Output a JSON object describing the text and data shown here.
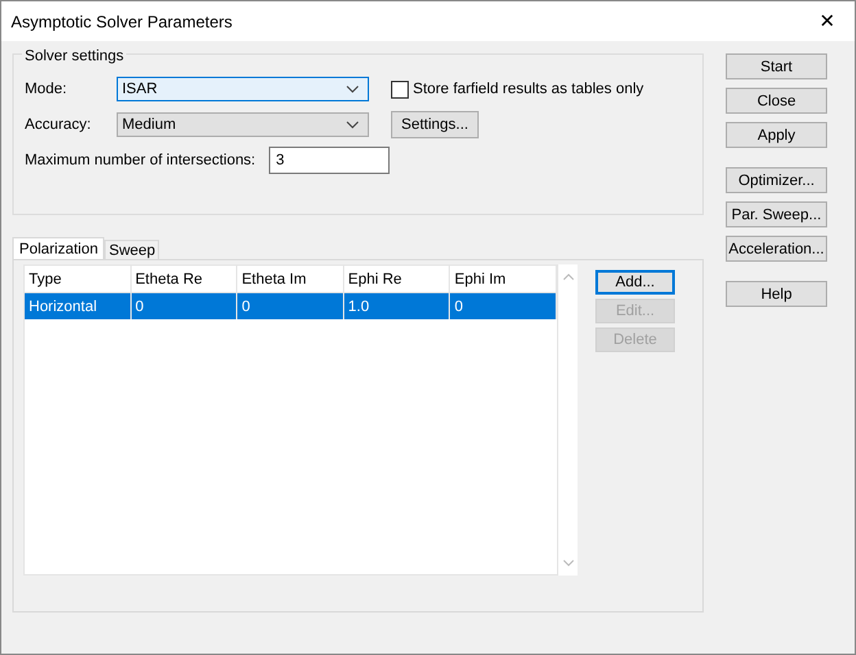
{
  "window": {
    "title": "Asymptotic Solver Parameters",
    "close": "✕"
  },
  "solver_settings": {
    "title": "Solver settings",
    "mode": {
      "label": "Mode:",
      "value": "ISAR",
      "focused": true
    },
    "accuracy": {
      "label": "Accuracy:",
      "value": "Medium"
    },
    "max_intersections": {
      "label": "Maximum number of intersections:",
      "value": "3"
    },
    "store_farfield": {
      "label": "Store farfield results as tables only",
      "checked": false
    },
    "settings_button": "Settings..."
  },
  "tabs": [
    {
      "label": "Polarization",
      "selected": true
    },
    {
      "label": "Sweep",
      "selected": false
    }
  ],
  "table": {
    "columns": [
      "Type",
      "Etheta Re",
      "Etheta Im",
      "Ephi Re",
      "Ephi Im"
    ],
    "rows": [
      {
        "cells": [
          "Horizontal",
          "0",
          "0",
          "1.0",
          "0"
        ],
        "selected": true
      }
    ]
  },
  "table_buttons": [
    {
      "label": "Add...",
      "disabled": false,
      "focused": true
    },
    {
      "label": "Edit...",
      "disabled": true,
      "focused": false
    },
    {
      "label": "Delete",
      "disabled": true,
      "focused": false
    }
  ],
  "side_button_groups": [
    [
      "Start",
      "Close",
      "Apply"
    ],
    [
      "Optimizer...",
      "Par. Sweep...",
      "Acceleration..."
    ],
    [
      "Help"
    ]
  ]
}
